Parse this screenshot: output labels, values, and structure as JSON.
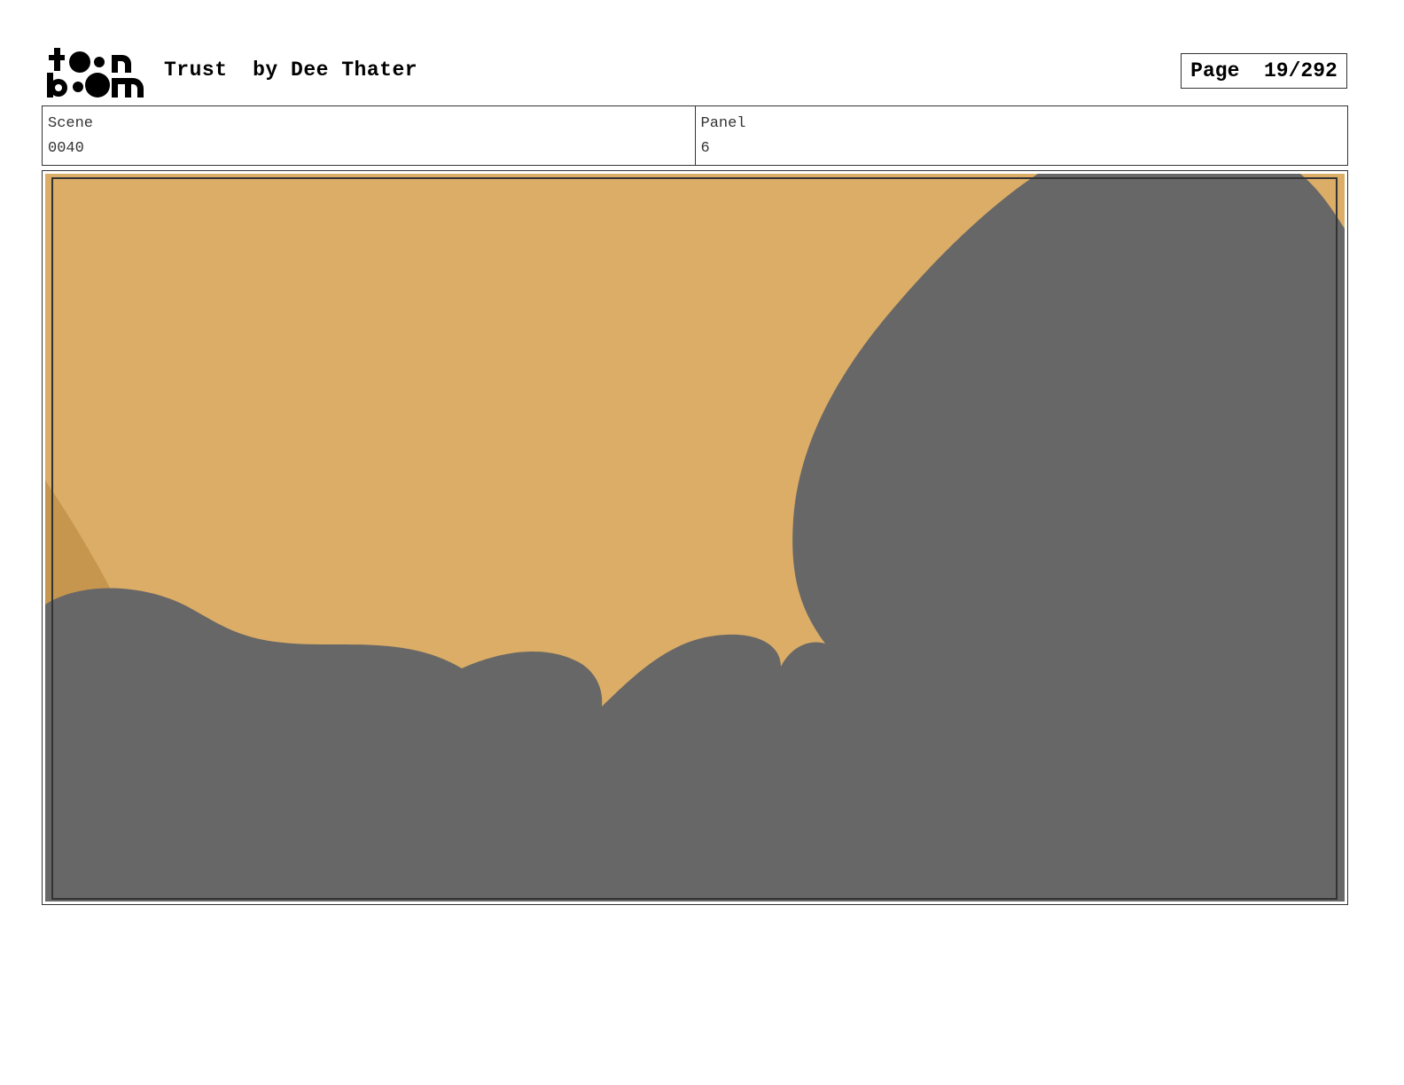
{
  "header": {
    "logo_line1": "t••n",
    "logo_line2": "b••m",
    "title": "Trust  by Dee Thater",
    "page_label": "Page  19/292"
  },
  "info": {
    "scene_label": "Scene",
    "scene_value": "0040",
    "panel_label": "Panel",
    "panel_value": "6"
  },
  "colors": {
    "sky": "#dbad67",
    "sky_shadow": "#c7964e",
    "silhouette": "#676767",
    "safe_frame": "#333333"
  }
}
